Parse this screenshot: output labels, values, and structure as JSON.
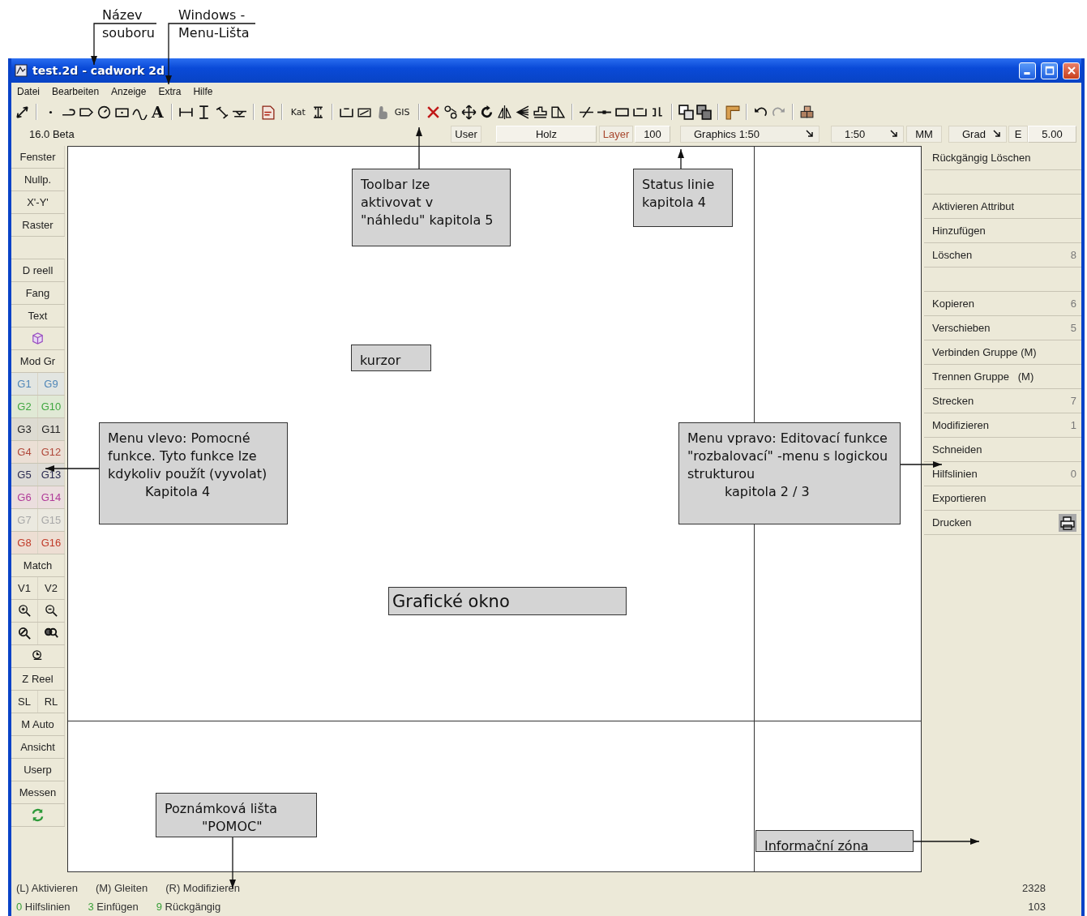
{
  "window": {
    "title": "test.2d - cadwork 2d"
  },
  "menu_bar": [
    "Datei",
    "Bearbeiten",
    "Anzeige",
    "Extra",
    "Hilfe"
  ],
  "toolbar": {
    "labels": [
      "A",
      "Kat",
      "GIS"
    ]
  },
  "status_line": {
    "version": "16.0 Beta",
    "items": [
      {
        "kind": "label",
        "text": "User"
      },
      {
        "kind": "field",
        "text": "Holz"
      },
      {
        "kind": "label",
        "text": "Layer",
        "color": "#a8482e"
      },
      {
        "kind": "field",
        "text": "100"
      },
      {
        "kind": "dropdown",
        "text": "Graphics 1:50"
      },
      {
        "kind": "dropdown",
        "text": "1:50"
      },
      {
        "kind": "label",
        "text": "MM"
      },
      {
        "kind": "dropdown",
        "text": "Grad"
      },
      {
        "kind": "label",
        "text": "E"
      },
      {
        "kind": "field",
        "text": "5.00"
      }
    ]
  },
  "left_menu": [
    {
      "kind": "buttons",
      "cells": [
        {
          "kind": "text",
          "label": "Fenster"
        }
      ]
    },
    {
      "kind": "buttons",
      "cells": [
        {
          "kind": "text",
          "label": "Nullp."
        }
      ]
    },
    {
      "kind": "buttons",
      "cells": [
        {
          "kind": "text",
          "label": "X'-Y'"
        }
      ]
    },
    {
      "kind": "buttons",
      "cells": [
        {
          "kind": "text",
          "label": "Raster"
        }
      ]
    },
    {
      "kind": "spacer"
    },
    {
      "kind": "buttons",
      "cells": [
        {
          "kind": "text",
          "label": "D reell"
        }
      ]
    },
    {
      "kind": "buttons",
      "cells": [
        {
          "kind": "text",
          "label": "Fang"
        }
      ]
    },
    {
      "kind": "buttons",
      "cells": [
        {
          "kind": "text",
          "label": "Text"
        }
      ]
    },
    {
      "kind": "buttons",
      "cells": [
        {
          "kind": "cube"
        }
      ]
    },
    {
      "kind": "buttons",
      "cells": [
        {
          "kind": "text",
          "label": "Mod Gr"
        }
      ]
    },
    {
      "kind": "buttons",
      "cells": [
        {
          "kind": "text",
          "label": "G1",
          "color": "#4f86b8"
        },
        {
          "kind": "text",
          "label": "G9",
          "color": "#4f86b8"
        }
      ]
    },
    {
      "kind": "buttons",
      "cells": [
        {
          "kind": "text",
          "label": "G2",
          "color": "#3fa63f"
        },
        {
          "kind": "text",
          "label": "G10",
          "color": "#3fa63f"
        }
      ]
    },
    {
      "kind": "buttons",
      "cells": [
        {
          "kind": "text",
          "label": "G3",
          "color": "#222222"
        },
        {
          "kind": "text",
          "label": "G11",
          "color": "#222222"
        }
      ]
    },
    {
      "kind": "buttons",
      "cells": [
        {
          "kind": "text",
          "label": "G4",
          "color": "#b0483a"
        },
        {
          "kind": "text",
          "label": "G12",
          "color": "#b0483a"
        }
      ]
    },
    {
      "kind": "buttons",
      "cells": [
        {
          "kind": "text",
          "label": "G5",
          "color": "#2a2a50"
        },
        {
          "kind": "text",
          "label": "G13",
          "color": "#2a2a50"
        }
      ]
    },
    {
      "kind": "buttons",
      "cells": [
        {
          "kind": "text",
          "label": "G6",
          "color": "#b03a98"
        },
        {
          "kind": "text",
          "label": "G14",
          "color": "#b03a98"
        }
      ]
    },
    {
      "kind": "buttons",
      "cells": [
        {
          "kind": "text",
          "label": "G7",
          "color": "#a8a8a8"
        },
        {
          "kind": "text",
          "label": "G15",
          "color": "#a8a8a8"
        }
      ]
    },
    {
      "kind": "buttons",
      "cells": [
        {
          "kind": "text",
          "label": "G8",
          "color": "#c03a28"
        },
        {
          "kind": "text",
          "label": "G16",
          "color": "#c03a28"
        }
      ]
    },
    {
      "kind": "buttons",
      "cells": [
        {
          "kind": "text",
          "label": "Match"
        }
      ]
    },
    {
      "kind": "buttons",
      "cells": [
        {
          "kind": "text",
          "label": "V1"
        },
        {
          "kind": "text",
          "label": "V2"
        }
      ]
    },
    {
      "kind": "buttons",
      "cells": [
        {
          "kind": "zoom-in"
        },
        {
          "kind": "zoom-out"
        }
      ]
    },
    {
      "kind": "buttons",
      "cells": [
        {
          "kind": "zoom-pen"
        },
        {
          "kind": "zoom-double"
        }
      ]
    },
    {
      "kind": "buttons",
      "cells": [
        {
          "kind": "zoom-clock"
        }
      ]
    },
    {
      "kind": "buttons",
      "cells": [
        {
          "kind": "text",
          "label": "Z Reel"
        }
      ]
    },
    {
      "kind": "buttons",
      "cells": [
        {
          "kind": "text",
          "label": "SL"
        },
        {
          "kind": "text",
          "label": "RL"
        }
      ]
    },
    {
      "kind": "buttons",
      "cells": [
        {
          "kind": "text",
          "label": "M Auto"
        }
      ]
    },
    {
      "kind": "buttons",
      "cells": [
        {
          "kind": "text",
          "label": "Ansicht"
        }
      ]
    },
    {
      "kind": "buttons",
      "cells": [
        {
          "kind": "text",
          "label": "Userp"
        }
      ]
    },
    {
      "kind": "buttons",
      "cells": [
        {
          "kind": "text",
          "label": "Messen"
        }
      ]
    },
    {
      "kind": "buttons",
      "cells": [
        {
          "kind": "refresh"
        }
      ]
    }
  ],
  "right_menu": [
    {
      "kind": "command",
      "label": "Rückgängig Löschen"
    },
    {
      "kind": "spacer"
    },
    {
      "kind": "command",
      "label": "Aktivieren Attribut"
    },
    {
      "kind": "command",
      "label": "Hinzufügen"
    },
    {
      "kind": "command",
      "label": "Löschen",
      "shortcut": "8"
    },
    {
      "kind": "spacer"
    },
    {
      "kind": "command",
      "label": "Kopieren",
      "shortcut": "6"
    },
    {
      "kind": "command",
      "label": "Verschieben",
      "shortcut": "5"
    },
    {
      "kind": "command",
      "label": "Verbinden Gruppe (M)"
    },
    {
      "kind": "command",
      "label": "Trennen Gruppe   (M)"
    },
    {
      "kind": "command",
      "label": "Strecken",
      "shortcut": "7"
    },
    {
      "kind": "command",
      "label": "Modifizieren",
      "shortcut": "1"
    },
    {
      "kind": "command",
      "label": "Schneiden"
    },
    {
      "kind": "command",
      "label": "Hilfslinien",
      "shortcut": "0"
    },
    {
      "kind": "command",
      "label": "Exportieren"
    },
    {
      "kind": "print-command",
      "label": "Drucken"
    }
  ],
  "hint_bar": {
    "mouse": [
      "(L) Aktivieren",
      "(M) Gleiten",
      "(R) Modifizieren"
    ],
    "keys": [
      {
        "key": "0",
        "text": "Hilfslinien"
      },
      {
        "key": "3",
        "text": "Einfügen"
      },
      {
        "key": "9",
        "text": "Rückgängig"
      }
    ],
    "counters": [
      "2328",
      "103"
    ]
  },
  "annotations": [
    {
      "kind": "label",
      "lines": [
        {
          "text": "Název",
          "indent": false
        },
        {
          "text": "souboru",
          "indent": false
        }
      ]
    },
    {
      "kind": "label",
      "lines": [
        {
          "text": "Windows -",
          "indent": false
        },
        {
          "text": "Menu-Lišta",
          "indent": false
        }
      ]
    },
    {
      "kind": "box",
      "lines": [
        {
          "text": "Toolbar lze",
          "indent": false
        },
        {
          "text": "aktivovat v",
          "indent": false
        },
        {
          "text": "\"náhledu\" kapitola 5",
          "indent": false
        }
      ]
    },
    {
      "kind": "box",
      "lines": [
        {
          "text": "Status linie",
          "indent": false
        },
        {
          "text": "kapitola 4",
          "indent": false
        }
      ]
    },
    {
      "kind": "box",
      "lines": [
        {
          "text": "kurzor",
          "indent": false
        }
      ]
    },
    {
      "kind": "box",
      "lines": [
        {
          "text": "Menu vlevo: Pomocné",
          "indent": false
        },
        {
          "text": "funkce. Tyto funkce lze",
          "indent": false
        },
        {
          "text": "kdykoliv použít (vyvolat)",
          "indent": false
        },
        {
          "text": "Kapitola 4",
          "indent": true
        }
      ]
    },
    {
      "kind": "box",
      "lines": [
        {
          "text": "Menu vpravo: Editovací funkce",
          "indent": false
        },
        {
          "text": "\"rozbalovací\" -menu s logickou",
          "indent": false
        },
        {
          "text": "strukturou",
          "indent": false
        },
        {
          "text": "kapitola 2 / 3",
          "indent": true
        }
      ]
    },
    {
      "kind": "big-box",
      "lines": [
        {
          "text": "Grafické okno",
          "indent": false
        }
      ]
    },
    {
      "kind": "box",
      "lines": [
        {
          "text": "Poznámková lišta",
          "indent": false
        },
        {
          "text": "\"POMOC\"",
          "indent": true
        }
      ]
    },
    {
      "kind": "box",
      "lines": [
        {
          "text": "Informační zóna",
          "indent": false
        }
      ]
    }
  ]
}
